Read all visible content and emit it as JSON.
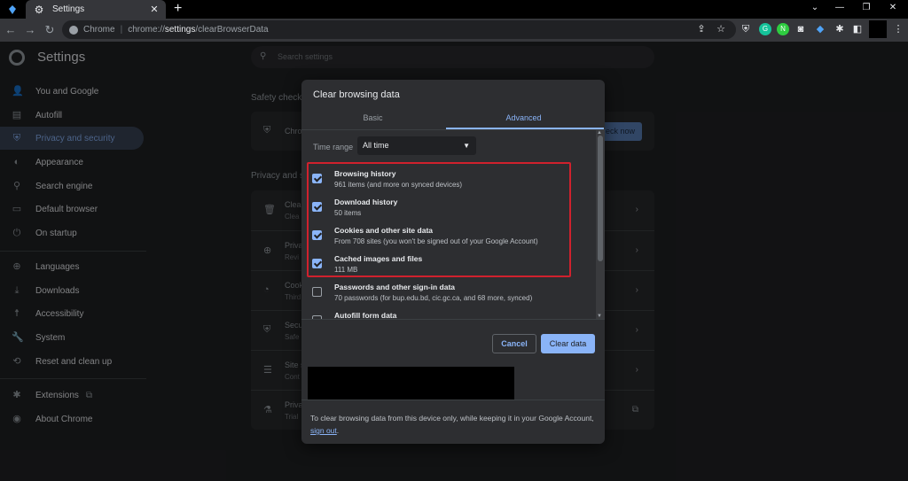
{
  "window": {
    "tab_title": "Settings",
    "tab_close": "✕",
    "new_tab": "+",
    "controls": [
      "⌄",
      "—",
      "❐",
      "✕"
    ]
  },
  "toolbar": {
    "back": "←",
    "forward": "→",
    "reload": "↻",
    "omnibox_label": "Chrome",
    "url_prefix": "chrome://",
    "url_bold": "settings",
    "url_suffix": "/clearBrowserData",
    "menu": "⋮"
  },
  "settings": {
    "title": "Settings",
    "search_placeholder": "Search settings"
  },
  "sidebar": {
    "items": [
      {
        "label": "You and Google",
        "icon": "person-icon",
        "glyph": "👤"
      },
      {
        "label": "Autofill",
        "icon": "clipboard-icon",
        "glyph": "▤"
      },
      {
        "label": "Privacy and security",
        "icon": "shield-icon",
        "glyph": "⛨"
      },
      {
        "label": "Appearance",
        "icon": "palette-icon",
        "glyph": "◐"
      },
      {
        "label": "Search engine",
        "icon": "search-icon",
        "glyph": "⚲"
      },
      {
        "label": "Default browser",
        "icon": "browser-icon",
        "glyph": "▭"
      },
      {
        "label": "On startup",
        "icon": "power-icon",
        "glyph": "⏻"
      },
      {
        "label": "Languages",
        "icon": "globe-icon",
        "glyph": "⊕"
      },
      {
        "label": "Downloads",
        "icon": "download-icon",
        "glyph": "⤓"
      },
      {
        "label": "Accessibility",
        "icon": "accessibility-icon",
        "glyph": "☨"
      },
      {
        "label": "System",
        "icon": "wrench-icon",
        "glyph": "🔧"
      },
      {
        "label": "Reset and clean up",
        "icon": "history-icon",
        "glyph": "⟲"
      },
      {
        "label": "Extensions",
        "icon": "puzzle-icon",
        "glyph": "✱"
      },
      {
        "label": "About Chrome",
        "icon": "chrome-icon",
        "glyph": "◉"
      }
    ]
  },
  "main": {
    "safety_check_label": "Safety check",
    "privacy_label": "Privacy and s",
    "check_now": "eck now",
    "safety_row_title": "Chro",
    "privacy_rows": [
      {
        "title": "Clea",
        "subtitle": "Clea",
        "glyph": "🗑"
      },
      {
        "title": "Priva",
        "subtitle": "Revi",
        "glyph": "⊕"
      },
      {
        "title": "Cook",
        "subtitle": "Third",
        "glyph": "◔"
      },
      {
        "title": "Secu",
        "subtitle": "Safe",
        "glyph": "⛨"
      },
      {
        "title": "Site s",
        "subtitle": "Cont",
        "glyph": "☰"
      },
      {
        "title": "Priva",
        "subtitle": "Trial",
        "glyph": "⚗"
      }
    ]
  },
  "dialog": {
    "title": "Clear browsing data",
    "tabs": {
      "basic": "Basic",
      "advanced": "Advanced"
    },
    "time_range_label": "Time range",
    "time_range_value": "All time",
    "options": [
      {
        "title": "Browsing history",
        "subtitle": "961 items (and more on synced devices)",
        "checked": true
      },
      {
        "title": "Download history",
        "subtitle": "50 items",
        "checked": true
      },
      {
        "title": "Cookies and other site data",
        "subtitle": "From 708 sites (you won't be signed out of your Google Account)",
        "checked": true
      },
      {
        "title": "Cached images and files",
        "subtitle": "111 MB",
        "checked": true
      },
      {
        "title": "Passwords and other sign-in data",
        "subtitle": "70 passwords (for bup.edu.bd, cic.gc.ca, and 68 more, synced)",
        "checked": false
      },
      {
        "title": "Autofill form data",
        "subtitle": "",
        "checked": false
      }
    ],
    "cancel_label": "Cancel",
    "clear_label": "Clear data",
    "footer_text": "To clear browsing data from this device only, while keeping it in your Google Account,",
    "footer_link": "sign out",
    "footer_end": "."
  },
  "colors": {
    "accent": "#8ab4f8",
    "highlight_box": "#d0212d",
    "background": "#202124"
  }
}
